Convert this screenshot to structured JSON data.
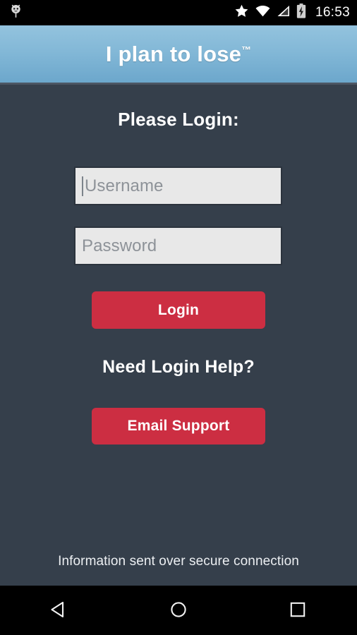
{
  "status_bar": {
    "notification_icon": "app-notification-icon",
    "icons": [
      "star-icon",
      "wifi-icon",
      "cellular-signal-icon",
      "battery-charging-icon"
    ],
    "clock": "16:53",
    "background_color": "#000000",
    "text_color": "#ffffff"
  },
  "header": {
    "title": "I plan to lose",
    "trademark": "™",
    "gradient_top": "#93c3de",
    "gradient_bottom": "#6ca7cc",
    "text_color": "#ffffff"
  },
  "main": {
    "background_color": "#353f4b",
    "heading": "Please Login:",
    "username_field": {
      "value": "",
      "placeholder": "Username",
      "focused": true,
      "background_color": "#e8e8e8",
      "border_color": "#2b333d",
      "placeholder_color": "#8d9298"
    },
    "password_field": {
      "value": "",
      "placeholder": "Password",
      "focused": false,
      "background_color": "#e8e8e8",
      "border_color": "#2b333d",
      "placeholder_color": "#8d9298"
    },
    "login_button": {
      "label": "Login",
      "color": "#cc2e42",
      "text_color": "#ffffff"
    },
    "help_heading": "Need Login Help?",
    "support_button": {
      "label": "Email Support",
      "color": "#cc2e42",
      "text_color": "#ffffff"
    },
    "footer_note": "Information sent over secure connection"
  },
  "nav_bar": {
    "background_color": "#000000",
    "buttons": [
      {
        "name": "back",
        "icon": "back-triangle-icon"
      },
      {
        "name": "home",
        "icon": "home-circle-icon"
      },
      {
        "name": "recents",
        "icon": "recents-square-icon"
      }
    ]
  }
}
